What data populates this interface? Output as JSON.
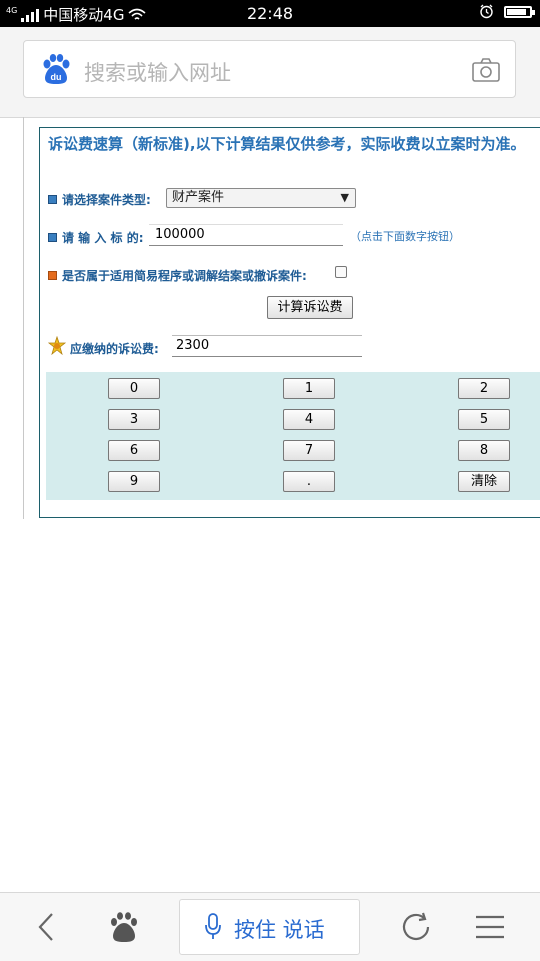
{
  "status_bar": {
    "signal_small": "4G",
    "carrier": "中国移动4G",
    "time": "22:48",
    "battery_level": 0.8
  },
  "search": {
    "placeholder": "搜索或输入网址",
    "logo_text": "du"
  },
  "form": {
    "title": "诉讼费速算（新标准),以下计算结果仅供参考，实际收费以立案时为准。",
    "case_type_label": "请选择案件类型:",
    "case_type_selected": "财产案件",
    "amount_label": "请 输 入 标 的:",
    "amount_value": "100000",
    "amount_hint": "（点击下面数字按钮）",
    "simple_procedure_label": "是否属于适用简易程序或调解结案或撤诉案件:",
    "calc_button": "计算诉讼费",
    "fee_label": "应缴纳的诉讼费:",
    "fee_value": "2300"
  },
  "keypad": {
    "keys": [
      "0",
      "1",
      "2",
      "3",
      "4",
      "5",
      "6",
      "7",
      "8",
      "9",
      ".",
      "清除"
    ]
  },
  "bottom_nav": {
    "voice_label": "按住 说话"
  },
  "colors": {
    "title_blue": "#2a72b5",
    "label_blue": "#1f5c95",
    "keypad_bg": "#d5eced",
    "panel_border": "#1c5e6b"
  }
}
